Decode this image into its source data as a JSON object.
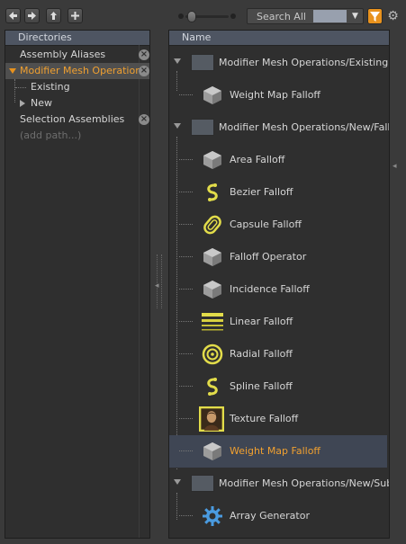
{
  "toolbar": {
    "back_icon": "arrow-left-icon",
    "forward_icon": "arrow-right-icon",
    "up_icon": "up-arrow-icon",
    "add_icon": "plus-icon",
    "search_label": "Search All",
    "filter_icon": "filter-icon",
    "settings_icon": "gear-icon",
    "accent_color": "#e8921d"
  },
  "directories": {
    "header": "Directories",
    "items": [
      {
        "label": "Assembly Aliases",
        "removable": true
      },
      {
        "label": "Modifier Mesh Operations",
        "removable": true,
        "selected": true,
        "expanded": true
      },
      {
        "label": "Existing",
        "child": true
      },
      {
        "label": "New",
        "child": true,
        "collapsed": true
      },
      {
        "label": "Selection Assemblies",
        "removable": true
      },
      {
        "label": "(add path...)",
        "placeholder": true
      }
    ]
  },
  "names": {
    "header": "Name",
    "rows": [
      {
        "label": "Modifier Mesh Operations/Existing",
        "type": "group",
        "icon": "folder-icon"
      },
      {
        "label": "Weight Map Falloff",
        "icon": "cube-icon"
      },
      {
        "label": "Modifier Mesh Operations/New/Falloffs",
        "type": "group",
        "icon": "folder-icon"
      },
      {
        "label": "Area Falloff",
        "icon": "cube-icon"
      },
      {
        "label": "Bezier Falloff",
        "icon": "bezier-falloff-icon"
      },
      {
        "label": "Capsule Falloff",
        "icon": "capsule-falloff-icon"
      },
      {
        "label": "Falloff Operator",
        "icon": "cube-icon"
      },
      {
        "label": "Incidence Falloff",
        "icon": "cube-icon"
      },
      {
        "label": "Linear Falloff",
        "icon": "linear-falloff-icon"
      },
      {
        "label": "Radial Falloff",
        "icon": "radial-falloff-icon"
      },
      {
        "label": "Spline Falloff",
        "icon": "spline-falloff-icon"
      },
      {
        "label": "Texture Falloff",
        "icon": "texture-falloff-icon"
      },
      {
        "label": "Weight Map Falloff",
        "icon": "cube-icon",
        "selected": true
      },
      {
        "label": "Modifier Mesh Operations/New/Sub-...",
        "type": "group",
        "icon": "folder-icon"
      },
      {
        "label": "Array Generator",
        "icon": "gear-icon"
      }
    ]
  }
}
